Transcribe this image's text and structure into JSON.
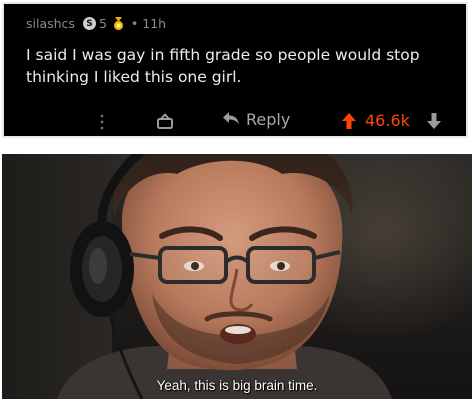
{
  "comment": {
    "username": "silashcs",
    "karma_badge": "5",
    "award_count": "5",
    "timestamp": "11h",
    "text": "I said I was gay in fifth grade so people would stop thinking I liked this one girl.",
    "reply_label": "Reply",
    "score": "46.6k",
    "colors": {
      "background": "#000000",
      "text": "#ececec",
      "muted": "#8a8a8a",
      "upvote": "#ff4500"
    },
    "icons": [
      "more-vertical-icon",
      "gift-icon",
      "reply-arrow-icon",
      "upvote-arrow-icon",
      "downvote-arrow-icon"
    ]
  },
  "meme": {
    "caption": "Yeah, this is big brain time."
  }
}
